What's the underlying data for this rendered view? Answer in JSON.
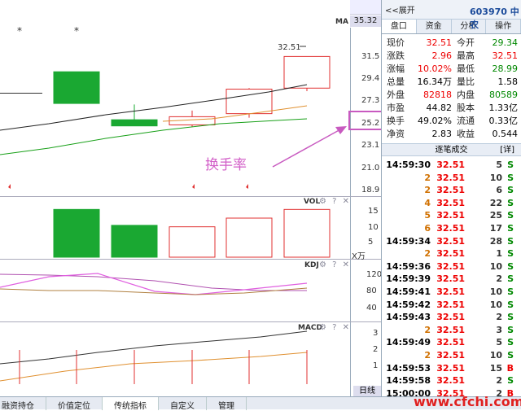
{
  "chart": {
    "ma_label": "MA",
    "price_top": "35.32",
    "price_ticks": [
      "31.5",
      "29.4",
      "27.3",
      "25.2",
      "23.1",
      "21.0",
      "18.9"
    ],
    "vol_title": "VOL",
    "vol_ticks": [
      "15",
      "10",
      "5"
    ],
    "vol_unit": "X万",
    "kdj_title": "KDJ",
    "kdj_ticks": [
      "120",
      "80",
      "40"
    ],
    "macd_title": "MACD",
    "macd_ticks": [
      "3",
      "2",
      "1"
    ],
    "high_label": "32.51",
    "panel_icons": "⚙ ? ✕",
    "star": "*",
    "annotation": "换手率",
    "period_tab": "日线"
  },
  "chart_data": {
    "type": "candlestick",
    "candles": [
      {
        "open": 31.0,
        "close": 27.9,
        "high": 31.0,
        "low": 27.9,
        "color": "green"
      },
      {
        "open": 26.3,
        "close": 25.7,
        "high": 27.8,
        "low": 25.7,
        "color": "green"
      },
      {
        "open": 25.8,
        "close": 26.6,
        "high": 27.2,
        "low": 25.6,
        "color": "red"
      },
      {
        "open": 26.9,
        "close": 29.3,
        "high": 29.4,
        "low": 26.5,
        "color": "red"
      },
      {
        "open": 29.4,
        "close": 32.5,
        "high": 32.5,
        "low": 29.1,
        "color": "red"
      }
    ],
    "volume": [
      16.5,
      11.0,
      10.5,
      13.5,
      16.5
    ],
    "ylim": [
      18.9,
      35.32
    ]
  },
  "bottom_tabs": [
    "融资持仓",
    "价值定位",
    "传统指标",
    "自定义",
    "管理"
  ],
  "right_panel": {
    "expand": "<<展开",
    "code": "603970 中农",
    "tabs": [
      "盘口",
      "资金",
      "分析",
      "操作"
    ],
    "quote": [
      {
        "l1": "现价",
        "v1": "32.51",
        "c1": "red",
        "l2": "今开",
        "v2": "29.34",
        "c2": "green"
      },
      {
        "l1": "涨跌",
        "v1": "2.96",
        "c1": "red",
        "l2": "最高",
        "v2": "32.51",
        "c2": "red"
      },
      {
        "l1": "涨幅",
        "v1": "10.02%",
        "c1": "red",
        "l2": "最低",
        "v2": "28.99",
        "c2": "green"
      },
      {
        "l1": "总量",
        "v1": "16.34万",
        "c1": "black",
        "l2": "量比",
        "v2": "1.58",
        "c2": "black"
      },
      {
        "l1": "外盘",
        "v1": "82818",
        "c1": "red",
        "l2": "内盘",
        "v2": "80589",
        "c2": "green"
      },
      {
        "l1": "市盈",
        "v1": "44.82",
        "c1": "black",
        "l2": "股本",
        "v2": "1.33亿",
        "c2": "black"
      },
      {
        "l1": "换手",
        "v1": "49.02%",
        "c1": "black",
        "l2": "流通",
        "v2": "0.33亿",
        "c2": "black"
      },
      {
        "l1": "净资",
        "v1": "2.83",
        "c1": "black",
        "l2": "收益(三)",
        "v2": "0.544",
        "c2": "black"
      }
    ],
    "trade_title": "逐笔成交",
    "trade_detail": "[详]",
    "trades": [
      {
        "time": "14:59:30",
        "price": "32.51",
        "vol": "5",
        "dir": "S"
      },
      {
        "time": "2",
        "price": "32.51",
        "vol": "10",
        "dir": "S"
      },
      {
        "time": "2",
        "price": "32.51",
        "vol": "6",
        "dir": "S"
      },
      {
        "time": "4",
        "price": "32.51",
        "vol": "22",
        "dir": "S"
      },
      {
        "time": "5",
        "price": "32.51",
        "vol": "25",
        "dir": "S"
      },
      {
        "time": "6",
        "price": "32.51",
        "vol": "17",
        "dir": "S"
      },
      {
        "time": "14:59:34",
        "price": "32.51",
        "vol": "28",
        "dir": "S"
      },
      {
        "time": "2",
        "price": "32.51",
        "vol": "1",
        "dir": "S"
      },
      {
        "time": "14:59:36",
        "price": "32.51",
        "vol": "10",
        "dir": "S"
      },
      {
        "time": "14:59:39",
        "price": "32.51",
        "vol": "2",
        "dir": "S"
      },
      {
        "time": "14:59:41",
        "price": "32.51",
        "vol": "10",
        "dir": "S"
      },
      {
        "time": "14:59:42",
        "price": "32.51",
        "vol": "10",
        "dir": "S"
      },
      {
        "time": "14:59:43",
        "price": "32.51",
        "vol": "2",
        "dir": "S"
      },
      {
        "time": "2",
        "price": "32.51",
        "vol": "3",
        "dir": "S"
      },
      {
        "time": "14:59:49",
        "price": "32.51",
        "vol": "5",
        "dir": "S"
      },
      {
        "time": "2",
        "price": "32.51",
        "vol": "10",
        "dir": "S"
      },
      {
        "time": "14:59:53",
        "price": "32.51",
        "vol": "15",
        "dir": "B"
      },
      {
        "time": "14:59:58",
        "price": "32.51",
        "vol": "2",
        "dir": "S"
      },
      {
        "time": "15:00:00",
        "price": "32.51",
        "vol": "2",
        "dir": "B"
      }
    ]
  },
  "watermark": "www.cfchi.com"
}
